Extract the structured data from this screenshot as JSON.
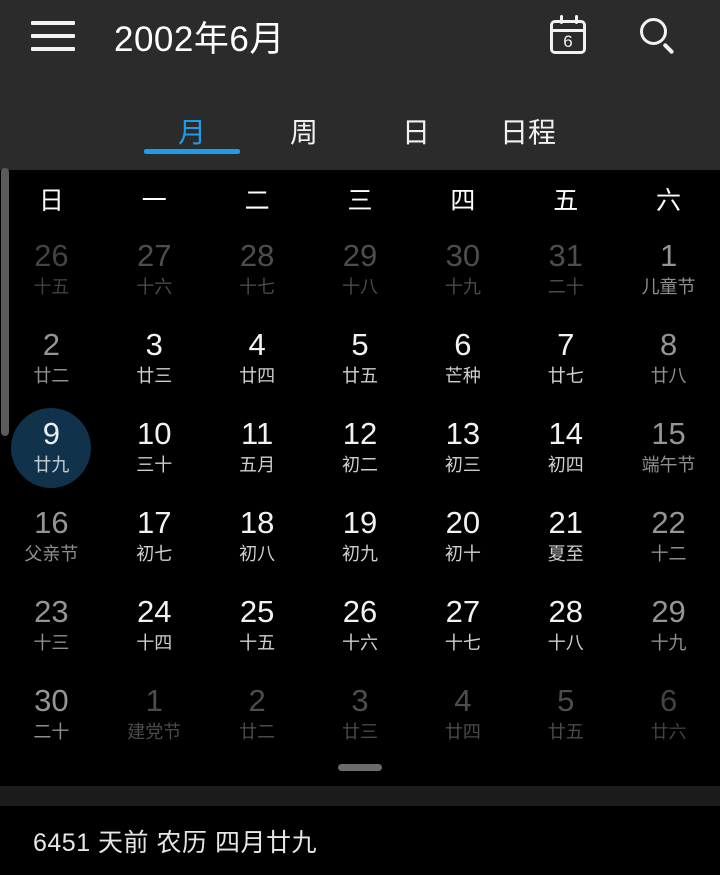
{
  "header": {
    "title": "2002年6月",
    "menu_icon": "hamburger-menu-icon",
    "today_icon": "calendar-today-icon",
    "today_icon_number": "6",
    "search_icon": "search-icon"
  },
  "tabs": [
    {
      "label": "月",
      "active": true
    },
    {
      "label": "周",
      "active": false
    },
    {
      "label": "日",
      "active": false
    },
    {
      "label": "日程",
      "active": false
    }
  ],
  "weekdays": [
    "日",
    "一",
    "二",
    "三",
    "四",
    "五",
    "六"
  ],
  "weeks": [
    [
      {
        "day": "26",
        "lunar": "十五",
        "other": true,
        "weekend": true,
        "selected": false
      },
      {
        "day": "27",
        "lunar": "十六",
        "other": true,
        "weekend": false,
        "selected": false
      },
      {
        "day": "28",
        "lunar": "十七",
        "other": true,
        "weekend": false,
        "selected": false
      },
      {
        "day": "29",
        "lunar": "十八",
        "other": true,
        "weekend": false,
        "selected": false
      },
      {
        "day": "30",
        "lunar": "十九",
        "other": true,
        "weekend": false,
        "selected": false
      },
      {
        "day": "31",
        "lunar": "二十",
        "other": true,
        "weekend": false,
        "selected": false
      },
      {
        "day": "1",
        "lunar": "儿童节",
        "other": false,
        "weekend": true,
        "selected": false
      }
    ],
    [
      {
        "day": "2",
        "lunar": "廿二",
        "other": false,
        "weekend": true,
        "selected": false
      },
      {
        "day": "3",
        "lunar": "廿三",
        "other": false,
        "weekend": false,
        "selected": false
      },
      {
        "day": "4",
        "lunar": "廿四",
        "other": false,
        "weekend": false,
        "selected": false
      },
      {
        "day": "5",
        "lunar": "廿五",
        "other": false,
        "weekend": false,
        "selected": false
      },
      {
        "day": "6",
        "lunar": "芒种",
        "other": false,
        "weekend": false,
        "selected": false
      },
      {
        "day": "7",
        "lunar": "廿七",
        "other": false,
        "weekend": false,
        "selected": false
      },
      {
        "day": "8",
        "lunar": "廿八",
        "other": false,
        "weekend": true,
        "selected": false
      }
    ],
    [
      {
        "day": "9",
        "lunar": "廿九",
        "other": false,
        "weekend": true,
        "selected": true
      },
      {
        "day": "10",
        "lunar": "三十",
        "other": false,
        "weekend": false,
        "selected": false
      },
      {
        "day": "11",
        "lunar": "五月",
        "other": false,
        "weekend": false,
        "selected": false
      },
      {
        "day": "12",
        "lunar": "初二",
        "other": false,
        "weekend": false,
        "selected": false
      },
      {
        "day": "13",
        "lunar": "初三",
        "other": false,
        "weekend": false,
        "selected": false
      },
      {
        "day": "14",
        "lunar": "初四",
        "other": false,
        "weekend": false,
        "selected": false
      },
      {
        "day": "15",
        "lunar": "端午节",
        "other": false,
        "weekend": true,
        "selected": false
      }
    ],
    [
      {
        "day": "16",
        "lunar": "父亲节",
        "other": false,
        "weekend": true,
        "selected": false
      },
      {
        "day": "17",
        "lunar": "初七",
        "other": false,
        "weekend": false,
        "selected": false
      },
      {
        "day": "18",
        "lunar": "初八",
        "other": false,
        "weekend": false,
        "selected": false
      },
      {
        "day": "19",
        "lunar": "初九",
        "other": false,
        "weekend": false,
        "selected": false
      },
      {
        "day": "20",
        "lunar": "初十",
        "other": false,
        "weekend": false,
        "selected": false
      },
      {
        "day": "21",
        "lunar": "夏至",
        "other": false,
        "weekend": false,
        "selected": false
      },
      {
        "day": "22",
        "lunar": "十二",
        "other": false,
        "weekend": true,
        "selected": false
      }
    ],
    [
      {
        "day": "23",
        "lunar": "十三",
        "other": false,
        "weekend": true,
        "selected": false
      },
      {
        "day": "24",
        "lunar": "十四",
        "other": false,
        "weekend": false,
        "selected": false
      },
      {
        "day": "25",
        "lunar": "十五",
        "other": false,
        "weekend": false,
        "selected": false
      },
      {
        "day": "26",
        "lunar": "十六",
        "other": false,
        "weekend": false,
        "selected": false
      },
      {
        "day": "27",
        "lunar": "十七",
        "other": false,
        "weekend": false,
        "selected": false
      },
      {
        "day": "28",
        "lunar": "十八",
        "other": false,
        "weekend": false,
        "selected": false
      },
      {
        "day": "29",
        "lunar": "十九",
        "other": false,
        "weekend": true,
        "selected": false
      }
    ],
    [
      {
        "day": "30",
        "lunar": "二十",
        "other": false,
        "weekend": true,
        "selected": false
      },
      {
        "day": "1",
        "lunar": "建党节",
        "other": true,
        "weekend": false,
        "selected": false
      },
      {
        "day": "2",
        "lunar": "廿二",
        "other": true,
        "weekend": false,
        "selected": false
      },
      {
        "day": "3",
        "lunar": "廿三",
        "other": true,
        "weekend": false,
        "selected": false
      },
      {
        "day": "4",
        "lunar": "廿四",
        "other": true,
        "weekend": false,
        "selected": false
      },
      {
        "day": "5",
        "lunar": "廿五",
        "other": true,
        "weekend": false,
        "selected": false
      },
      {
        "day": "6",
        "lunar": "廿六",
        "other": true,
        "weekend": true,
        "selected": false
      }
    ]
  ],
  "footer": {
    "text": "6451 天前  农历 四月廿九"
  },
  "colors": {
    "accent": "#1e9cec",
    "header_bg": "#2b2b2b",
    "page_bg": "#000000",
    "selected_circle": "#11324b"
  }
}
